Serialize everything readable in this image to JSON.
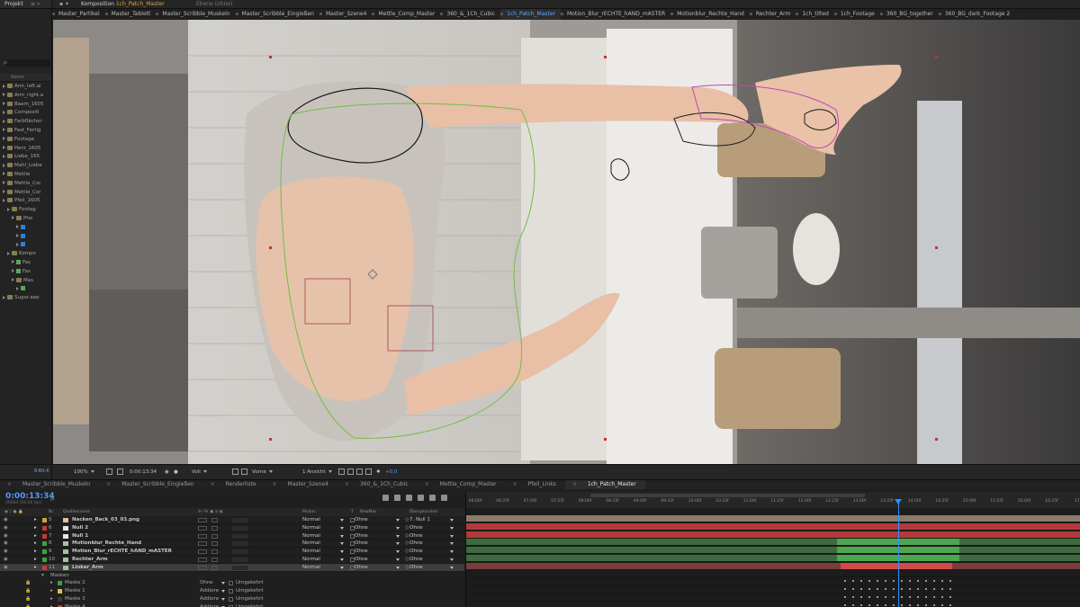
{
  "project": {
    "title": "Projekt",
    "search_placeholder": "ρ",
    "name_header": "Name",
    "items": [
      {
        "label": "Arm_left.ai",
        "kind": "folder"
      },
      {
        "label": "Arm_right.a",
        "kind": "folder"
      },
      {
        "label": "Baam_1605",
        "kind": "folder"
      },
      {
        "label": "Compositi",
        "kind": "folder"
      },
      {
        "label": "Farbflächer",
        "kind": "folder"
      },
      {
        "label": "Fast_Fertig",
        "kind": "folder"
      },
      {
        "label": "Footage",
        "kind": "folder"
      },
      {
        "label": "Herz_1605",
        "kind": "folder"
      },
      {
        "label": "Liebe_165",
        "kind": "folder"
      },
      {
        "label": "Mahl_Liebe",
        "kind": "folder"
      },
      {
        "label": "Mettle",
        "kind": "folder"
      },
      {
        "label": "Mettle_Cor",
        "kind": "folder"
      },
      {
        "label": "Mettle_Cor",
        "kind": "folder"
      },
      {
        "label": "Pfeil_1605",
        "kind": "folder"
      },
      {
        "label": "Footag",
        "kind": "folder"
      },
      {
        "label": "Pho",
        "kind": "folder"
      },
      {
        "label": "",
        "kind": "blue"
      },
      {
        "label": "",
        "kind": "blue"
      },
      {
        "label": "",
        "kind": "blue"
      },
      {
        "label": "Kompo",
        "kind": "folder"
      },
      {
        "label": "Fas",
        "kind": "green"
      },
      {
        "label": "Fas",
        "kind": "green"
      },
      {
        "label": "Mas",
        "kind": "folder"
      },
      {
        "label": "",
        "kind": "green"
      },
      {
        "label": "Sugar.aep",
        "kind": "folder"
      }
    ],
    "bpc": "8-Bit-K"
  },
  "composition": {
    "panel_label": "Komposition",
    "name": "1ch_Patch_Master",
    "layer_label": "Ebene (ohne)",
    "tabs": [
      "Master_Partikel",
      "Master_Tablett",
      "Master_Scribble_Muskeln",
      "Master_Scribble_Eingießen",
      "Master_Szene4",
      "Mettle_Comp_Master",
      "360_&_1Ch_Cubic",
      "1ch_Patch_Master",
      "Motion_Blur_rECHTE_hAND_mASTER",
      "Motionblur_Rechte_Hand",
      "Rechter_Arm",
      "1ch_tilted",
      "1ch_Footage",
      "360_BG_together",
      "360_BG_dark_Footage 2"
    ],
    "active_tab": 7
  },
  "viewer_bar": {
    "zoom": "100%",
    "time": "0:00:13:34",
    "resolution": "Voll",
    "view": "Vorne",
    "views": "1 Ansicht",
    "exposure": "+0,0"
  },
  "timeline": {
    "tabs": [
      "Master_Scribble_Muskeln",
      "Master_Scribble_Eingießen",
      "Renderliste",
      "Master_Szene4",
      "360_&_1Ch_Cubic",
      "Mettle_Comp_Master",
      "Pfeil_Links",
      "1ch_Patch_Master"
    ],
    "active_tab": 7,
    "timecode": "0:00:13:34",
    "timecode_sub": "00684 (50.00 fps)",
    "headers": {
      "nr": "Nr.",
      "source": "Quellenname",
      "mode": "Modus",
      "t": "T",
      "trkmat": "BewMas",
      "parent": "Übergeordnet"
    },
    "layers": [
      {
        "nr": "5",
        "name": "Nacken_Back_03_03.png",
        "mode": "Normal",
        "trk": "Ohne",
        "parent": "7. Null 1",
        "color": "#c7a83b",
        "icon": "#d9c6a0"
      },
      {
        "nr": "6",
        "name": "Null 2",
        "mode": "Normal",
        "trk": "Ohne",
        "parent": "Ohne",
        "color": "#c53a3a",
        "icon": "#e6e6e6"
      },
      {
        "nr": "7",
        "name": "Null 1",
        "mode": "Normal",
        "trk": "Ohne",
        "parent": "Ohne",
        "color": "#c53a3a",
        "icon": "#e6e6e6"
      },
      {
        "nr": "8",
        "name": "Motionblur_Rechte_Hand",
        "mode": "Normal",
        "trk": "Ohne",
        "parent": "Ohne",
        "color": "#3fa142",
        "icon": "#9fc59a"
      },
      {
        "nr": "9",
        "name": "Motion_Blur_rECHTE_hAND_mASTER",
        "mode": "Normal",
        "trk": "Ohne",
        "parent": "Ohne",
        "color": "#3fa142",
        "icon": "#9fc59a"
      },
      {
        "nr": "10",
        "name": "Rechter_Arm",
        "mode": "Normal",
        "trk": "Ohne",
        "parent": "Ohne",
        "color": "#3fa142",
        "icon": "#9fc59a"
      },
      {
        "nr": "11",
        "name": "Linker_Arm",
        "mode": "Normal",
        "trk": "Ohne",
        "parent": "Ohne",
        "color": "#c53a3a",
        "icon": "#9fc59a"
      }
    ],
    "masks_label": "Masken",
    "masks": [
      {
        "name": "Maske 2",
        "mode": "Ohne",
        "inv": "Umgekehrt",
        "color": "#3fa142"
      },
      {
        "name": "Maske 1",
        "mode": "Addiere",
        "inv": "Umgekehrt",
        "color": "#d8c33c"
      },
      {
        "name": "Maske 3",
        "mode": "Addiere",
        "inv": "Umgekehrt",
        "color": "#3a3a3a"
      },
      {
        "name": "Maske 4",
        "mode": "Addiere",
        "inv": "Umgekehrt",
        "color": "#c53a3a"
      }
    ],
    "ruler": [
      "06:00f",
      "06:25f",
      "07:00f",
      "07:25f",
      "08:00f",
      "08:25f",
      "09:00f",
      "09:25f",
      "10:00f",
      "10:25f",
      "11:00f",
      "11:25f",
      "12:00f",
      "12:25f",
      "13:00f",
      "13:25f",
      "14:00f",
      "14:25f",
      "15:00f",
      "15:25f",
      "16:00f",
      "16:25f",
      "17:0"
    ]
  }
}
